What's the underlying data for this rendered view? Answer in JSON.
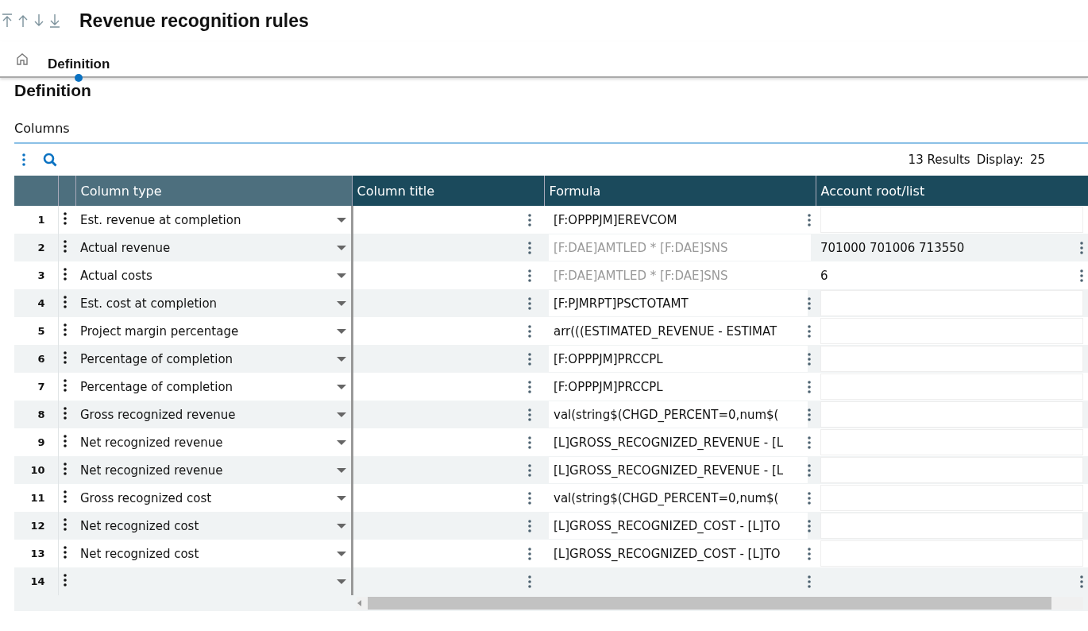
{
  "window": {
    "title": "Revenue recognition rules"
  },
  "tabs": [
    {
      "label": "Definition",
      "selected": true
    }
  ],
  "section": {
    "title": "Definition"
  },
  "block": {
    "title": "Columns",
    "results": "13 Results",
    "display_label": "Display:",
    "display_value": "25"
  },
  "table": {
    "columns": [
      "Column type",
      "Column title",
      "Formula",
      "Account root/list"
    ],
    "rows": [
      {
        "num": "1",
        "type": "Est. revenue at completion",
        "title": "",
        "formula": "[F:OPPPJM]EREVCOM",
        "formula_disabled": false,
        "account": "",
        "account_editable": false
      },
      {
        "num": "2",
        "type": "Actual revenue",
        "title": "",
        "formula": "[F:DAE]AMTLED * [F:DAE]SNS",
        "formula_disabled": true,
        "account": "701000 701006 713550",
        "account_editable": true
      },
      {
        "num": "3",
        "type": "Actual costs",
        "title": "",
        "formula": "[F:DAE]AMTLED * [F:DAE]SNS",
        "formula_disabled": true,
        "account": "6",
        "account_editable": true
      },
      {
        "num": "4",
        "type": "Est. cost at completion",
        "title": "",
        "formula": "[F:PJMRPT]PSCTOTAMT",
        "formula_disabled": false,
        "account": "",
        "account_editable": false
      },
      {
        "num": "5",
        "type": "Project margin percentage",
        "title": "",
        "formula": "arr(((ESTIMATED_REVENUE - ESTIMAT",
        "formula_disabled": false,
        "account": "",
        "account_editable": false
      },
      {
        "num": "6",
        "type": "Percentage of completion",
        "title": "",
        "formula": "[F:OPPPJM]PRCCPL",
        "formula_disabled": false,
        "account": "",
        "account_editable": false
      },
      {
        "num": "7",
        "type": "Percentage of completion",
        "title": "",
        "formula": "[F:OPPPJM]PRCCPL",
        "formula_disabled": false,
        "account": "",
        "account_editable": false
      },
      {
        "num": "8",
        "type": "Gross recognized revenue",
        "title": "",
        "formula": "val(string$(CHGD_PERCENT=0,num$(",
        "formula_disabled": false,
        "account": "",
        "account_editable": false
      },
      {
        "num": "9",
        "type": "Net recognized revenue",
        "title": "",
        "formula": "[L]GROSS_RECOGNIZED_REVENUE - [L",
        "formula_disabled": false,
        "account": "",
        "account_editable": false
      },
      {
        "num": "10",
        "type": "Net recognized revenue",
        "title": "",
        "formula": "[L]GROSS_RECOGNIZED_REVENUE - [L",
        "formula_disabled": false,
        "account": "",
        "account_editable": false
      },
      {
        "num": "11",
        "type": "Gross recognized cost",
        "title": "",
        "formula": "val(string$(CHGD_PERCENT=0,num$(",
        "formula_disabled": false,
        "account": "",
        "account_editable": false
      },
      {
        "num": "12",
        "type": "Net recognized cost",
        "title": "",
        "formula": "[L]GROSS_RECOGNIZED_COST - [L]TO",
        "formula_disabled": false,
        "account": "",
        "account_editable": false
      },
      {
        "num": "13",
        "type": "Net recognized cost",
        "title": "",
        "formula": "[L]GROSS_RECOGNIZED_COST - [L]TO",
        "formula_disabled": false,
        "account": "",
        "account_editable": false
      },
      {
        "num": "14",
        "type": "",
        "title": "",
        "formula": "",
        "formula_disabled": false,
        "account": "",
        "account_editable": true
      }
    ]
  }
}
